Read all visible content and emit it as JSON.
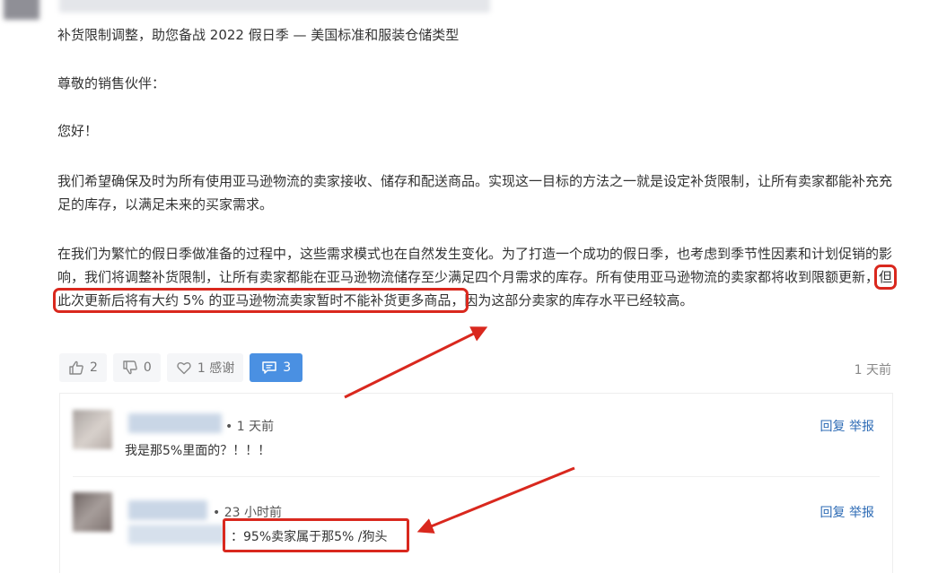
{
  "post": {
    "title": "补货限制调整，助您备战 2022 假日季 — 美国标准和服装仓储类型",
    "greeting": "尊敬的销售伙伴：",
    "hello": "您好！",
    "para1": "我们希望确保及时为所有使用亚马逊物流的卖家接收、储存和配送商品。实现这一目标的方法之一就是设定补货限制，让所有卖家都能补充充足的库存，以满足未来的买家需求。",
    "para2_before": "在我们为繁忙的假日季做准备的过程中，这些需求模式也在自然发生变化。为了打造一个成功的假日季，也考虑到季节性因素和计划促销的影响，我们将调整补货限制，让所有卖家都能在亚马逊物流储存至少满足四个月需求的库存。所有使用亚马逊物流的卖家都将收到限额更新，",
    "para2_highlight": "但此次更新后将有大约 5% 的亚马逊物流卖家暂时不能补货更多商品，",
    "para2_after": "因为这部分卖家的库存水平已经较高。"
  },
  "actions": {
    "like_count": "2",
    "dislike_count": "0",
    "thanks_label": "1 感谢",
    "comment_count": "3",
    "time": "1 天前"
  },
  "comments": [
    {
      "time": "• 1 天前",
      "text": "我是那5%里面的？！！！",
      "reply": "回复",
      "report": "举报"
    },
    {
      "time": "• 23 小时前",
      "text": "：95%卖家属于那5% /狗头",
      "reply": "回复",
      "report": "举报"
    }
  ],
  "colors": {
    "accent": "#4a90e2",
    "highlight": "#d9281e",
    "link": "#2d6bb5"
  },
  "icons": [
    "thumbs-up-icon",
    "thumbs-down-icon",
    "heart-icon",
    "comment-icon"
  ]
}
